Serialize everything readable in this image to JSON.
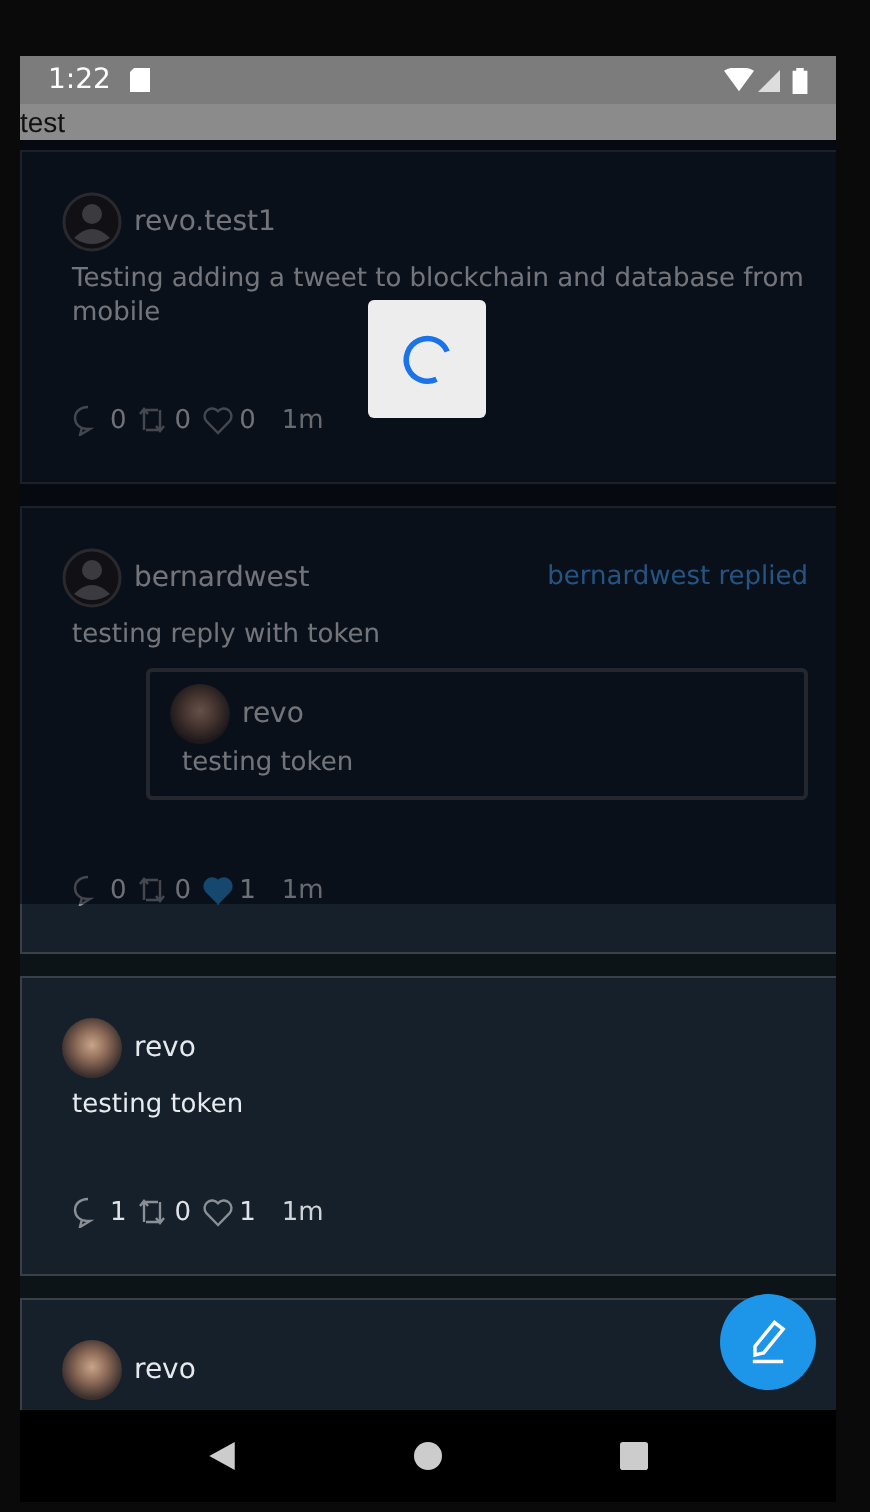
{
  "status_bar": {
    "time": "1:22"
  },
  "app_bar": {
    "title": "test"
  },
  "loading": true,
  "tweets": [
    {
      "author": "revo.test1",
      "avatar": {
        "kind": "default"
      },
      "text": "Testing adding a tweet to blockchain and database from mobile",
      "stats": {
        "replies": "0",
        "retweets": "0",
        "likes": "0",
        "liked": false,
        "time": "1m"
      }
    },
    {
      "author": "bernardwest",
      "avatar": {
        "kind": "default"
      },
      "replied_label": "bernardwest replied",
      "text": "testing reply with token",
      "quote": {
        "author": "revo",
        "avatar": {
          "kind": "photo"
        },
        "text": "testing token"
      },
      "stats": {
        "replies": "0",
        "retweets": "0",
        "likes": "1",
        "liked": true,
        "time": "1m"
      }
    },
    {
      "author": "revo",
      "avatar": {
        "kind": "photo"
      },
      "text": "testing token",
      "stats": {
        "replies": "1",
        "retweets": "0",
        "likes": "1",
        "liked": false,
        "time": "1m"
      }
    },
    {
      "author": "revo",
      "avatar": {
        "kind": "photo"
      }
    }
  ]
}
